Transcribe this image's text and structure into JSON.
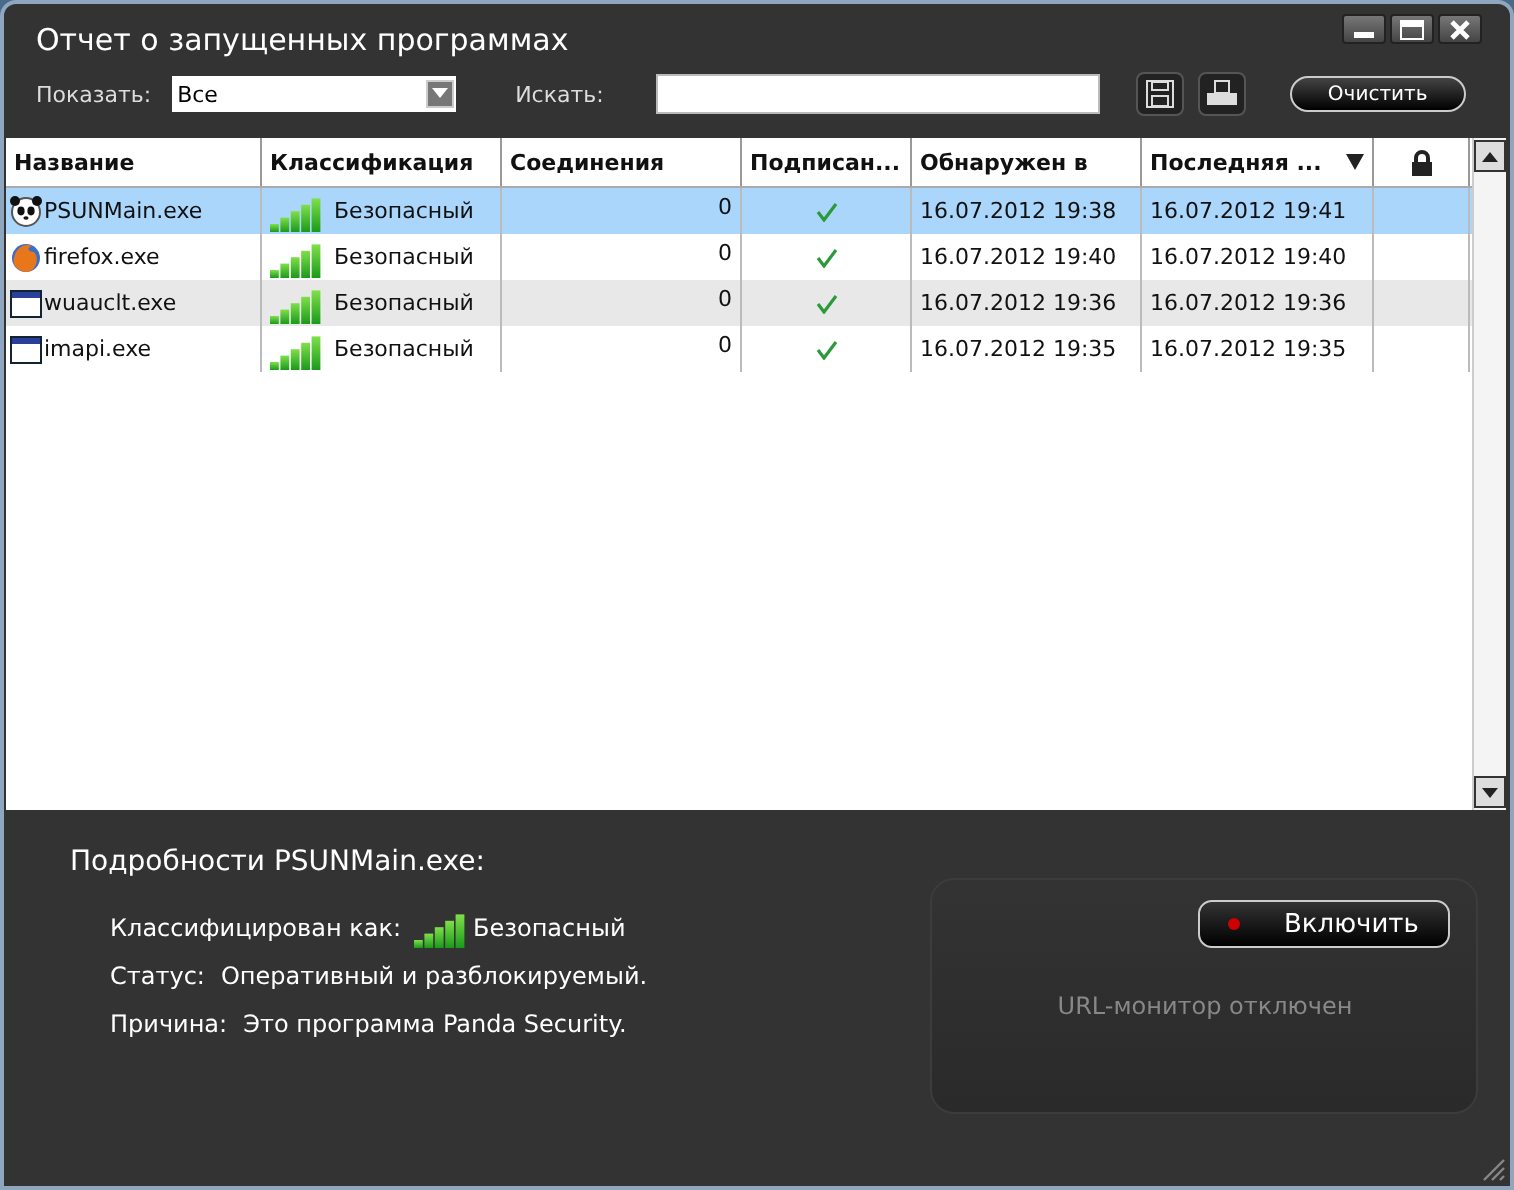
{
  "window": {
    "title": "Отчет о запущенных программах"
  },
  "filter": {
    "label": "Показать:",
    "value": "Все"
  },
  "search": {
    "label": "Искать:"
  },
  "clear_button": "Очистить",
  "table": {
    "columns": [
      {
        "kind": "text",
        "label": "Название",
        "sorted": false
      },
      {
        "kind": "text",
        "label": "Классификация",
        "sorted": false
      },
      {
        "kind": "text",
        "label": "Соединения",
        "sorted": false
      },
      {
        "kind": "text",
        "label": "Подписан...",
        "sorted": false
      },
      {
        "kind": "text",
        "label": "Обнаружен в",
        "sorted": false
      },
      {
        "kind": "text",
        "label": "Последняя ...",
        "sorted": true
      },
      {
        "kind": "lock",
        "sorted": false
      }
    ],
    "rows": [
      {
        "name": "PSUNMain.exe",
        "level": 1,
        "classification": "Безопасный",
        "connections": "0",
        "signed": true,
        "detected": "16.07.2012 19:38",
        "last": "16.07.2012 19:41",
        "selected": true
      },
      {
        "name": "firefox.exe",
        "level": 1,
        "classification": "Безопасный",
        "connections": "0",
        "signed": true,
        "detected": "16.07.2012 19:40",
        "last": "16.07.2012 19:40",
        "selected": false
      },
      {
        "name": "wuauclt.exe",
        "level": 1,
        "classification": "Безопасный",
        "connections": "0",
        "signed": true,
        "detected": "16.07.2012 19:36",
        "last": "16.07.2012 19:36",
        "selected": false
      },
      {
        "name": "imapi.exe",
        "level": 1,
        "classification": "Безопасный",
        "connections": "0",
        "signed": true,
        "detected": "16.07.2012 19:35",
        "last": "16.07.2012 19:35",
        "selected": false
      }
    ]
  },
  "details": {
    "title": "Подробности PSUNMain.exe:",
    "classified_label": "Классифицирован как:",
    "level": 1,
    "classification": "Безопасный",
    "status_label": "Статус:",
    "status": "Оперативный и разблокируемый.",
    "reason_label": "Причина:",
    "reason": "Это программа Panda Security."
  },
  "url_monitor": {
    "on": false,
    "button": "Включить",
    "message": "URL-монитор отключен"
  }
}
